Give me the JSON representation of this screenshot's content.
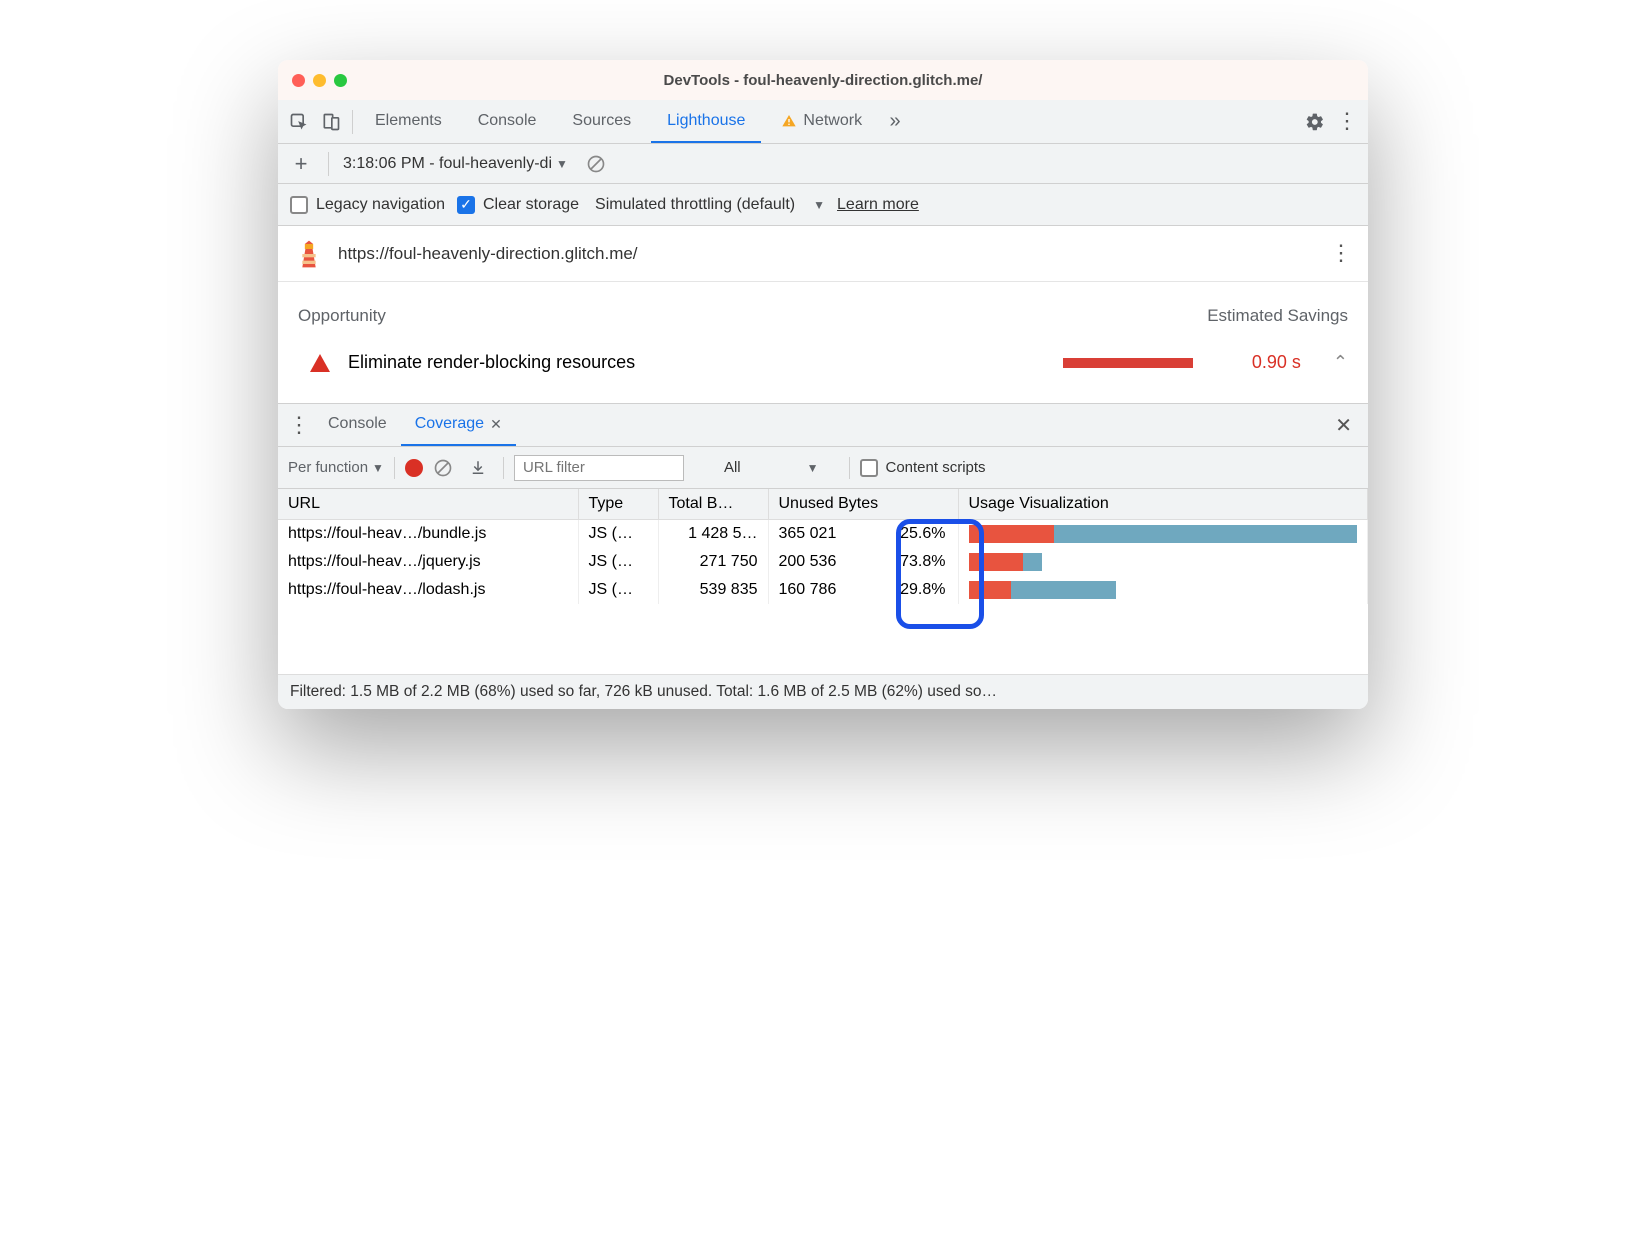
{
  "window": {
    "title": "DevTools - foul-heavenly-direction.glitch.me/"
  },
  "main_tabs": {
    "items": [
      "Elements",
      "Console",
      "Sources",
      "Lighthouse",
      "Network"
    ],
    "active": "Lighthouse",
    "network_warning": true
  },
  "lighthouse_toolbar": {
    "run_label": "3:18:06 PM - foul-heavenly-di"
  },
  "settings_row": {
    "legacy_label": "Legacy navigation",
    "legacy_checked": false,
    "clear_label": "Clear storage",
    "clear_checked": true,
    "throttling_label": "Simulated throttling (default)",
    "learn_more": "Learn more"
  },
  "url_row": {
    "url": "https://foul-heavenly-direction.glitch.me/"
  },
  "opportunity": {
    "header_left": "Opportunity",
    "header_right": "Estimated Savings",
    "title": "Eliminate render-blocking resources",
    "savings": "0.90 s"
  },
  "drawer": {
    "console_label": "Console",
    "coverage_label": "Coverage"
  },
  "coverage_toolbar": {
    "granularity": "Per function",
    "url_filter_placeholder": "URL filter",
    "type_filter": "All",
    "content_scripts_label": "Content scripts",
    "content_scripts_checked": false
  },
  "coverage_table": {
    "headers": {
      "url": "URL",
      "type": "Type",
      "total": "Total B…",
      "unused": "Unused Bytes",
      "viz": "Usage Visualization"
    },
    "rows": [
      {
        "url": "https://foul-heav…/bundle.js",
        "type": "JS (…",
        "total": "1 428 5…",
        "unused_bytes": "365 021",
        "unused_pct": "25.6%",
        "viz_red": 22,
        "viz_blue": 78
      },
      {
        "url": "https://foul-heav…/jquery.js",
        "type": "JS (…",
        "total": "271 750",
        "unused_bytes": "200 536",
        "unused_pct": "73.8%",
        "viz_red": 14,
        "viz_blue": 5
      },
      {
        "url": "https://foul-heav…/lodash.js",
        "type": "JS (…",
        "total": "539 835",
        "unused_bytes": "160 786",
        "unused_pct": "29.8%",
        "viz_red": 11,
        "viz_blue": 27
      }
    ]
  },
  "footer": {
    "text": "Filtered: 1.5 MB of 2.2 MB (68%) used so far, 726 kB unused. Total: 1.6 MB of 2.5 MB (62%) used so…"
  }
}
